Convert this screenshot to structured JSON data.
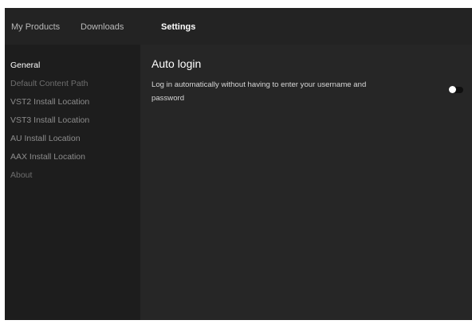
{
  "topnav": {
    "tabs": [
      {
        "label": "My Products"
      },
      {
        "label": "Downloads"
      },
      {
        "label": "Settings"
      }
    ],
    "active": "Settings"
  },
  "sidebar": {
    "items": [
      {
        "label": "General"
      },
      {
        "label": "Default Content Path"
      },
      {
        "label": "VST2 Install Location"
      },
      {
        "label": "VST3 Install Location"
      },
      {
        "label": "AU Install Location"
      },
      {
        "label": "AAX Install Location"
      },
      {
        "label": "About"
      }
    ],
    "active": "General"
  },
  "main": {
    "title": "Auto login",
    "description": "Log in automatically without having to enter your username and password",
    "toggle": {
      "state": "off"
    }
  },
  "colors": {
    "background": "#262626",
    "sidebar_bg": "#1d1d1d",
    "text_active": "#ffffff",
    "text_inactive": "#6e6e6e"
  }
}
